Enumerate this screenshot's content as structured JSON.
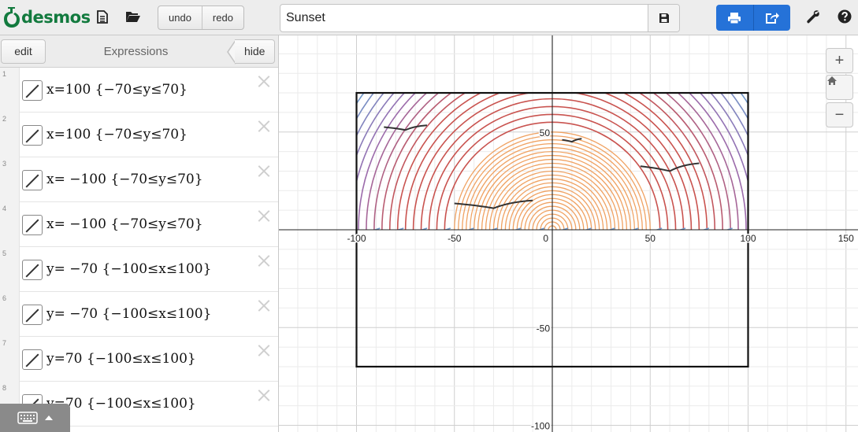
{
  "app": {
    "brand": "desmos",
    "undo_label": "undo",
    "redo_label": "redo",
    "graph_title": "Sunset",
    "icons": {
      "new_file": "document-icon",
      "open": "folder-icon",
      "save": "floppy-disk-icon",
      "print": "printer-icon",
      "share": "share-icon",
      "settings": "wrench-icon",
      "help": "question-icon"
    }
  },
  "panel": {
    "edit_label": "edit",
    "title": "Expressions",
    "hide_label": "hide",
    "keyboard_icon": "keyboard-icon",
    "expressions": [
      {
        "num": "1",
        "latex": "x=100 {−70≤y≤70}"
      },
      {
        "num": "2",
        "latex": "x=100 {−70≤y≤70}"
      },
      {
        "num": "3",
        "latex": "x= −100 {−70≤y≤70}"
      },
      {
        "num": "4",
        "latex": "x= −100 {−70≤y≤70}"
      },
      {
        "num": "5",
        "latex": "y= −70 {−100≤x≤100}"
      },
      {
        "num": "6",
        "latex": "y= −70 {−100≤x≤100}"
      },
      {
        "num": "7",
        "latex": "y=70 {−100≤x≤100}"
      },
      {
        "num": "8",
        "latex": "y=70 {−100≤x≤100}"
      }
    ]
  },
  "graph": {
    "x_ticks": [
      "-100",
      "-50",
      "0",
      "50",
      "100",
      "150"
    ],
    "y_ticks": [
      "50",
      "-50",
      "-100"
    ],
    "zoom_in": "+",
    "zoom_out": "−",
    "home_icon": "home-icon",
    "colors": {
      "sun": "#f0a262",
      "red": "#c9534f",
      "purple": "#9a6cb0",
      "blue": "#6e98c9",
      "frame": "#111111",
      "birds": "#333333"
    }
  }
}
